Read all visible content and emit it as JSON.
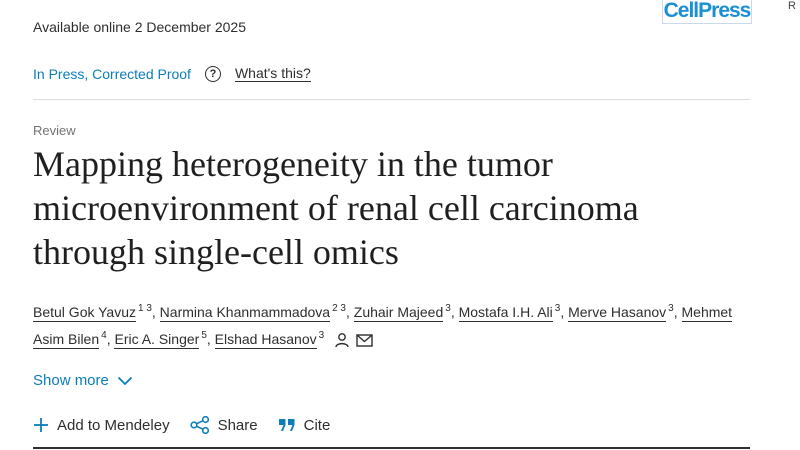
{
  "header": {
    "availability": "Available online 2 December 2025",
    "publisher_logo": "CellPress",
    "edge_text": "R"
  },
  "status": {
    "label": "In Press, Corrected Proof",
    "help_icon": "question-circle-icon",
    "whats_this": "What's this?"
  },
  "article": {
    "type": "Review",
    "title": "Mapping heterogeneity in the tumor microenvironment of renal cell carcinoma through single-cell omics"
  },
  "authors": [
    {
      "name": "Betul Gok Yavuz",
      "aff": "1 3",
      "sep": ","
    },
    {
      "name": "Narmina Khanmammadova",
      "aff": "2 3",
      "sep": ","
    },
    {
      "name": "Zuhair Majeed",
      "aff": "3",
      "sep": ","
    },
    {
      "name": "Mostafa I.H. Ali",
      "aff": "3",
      "sep": ","
    },
    {
      "name": "Merve Hasanov",
      "aff": "3",
      "sep": ","
    },
    {
      "name": "Mehmet Asim Bilen",
      "aff": "4",
      "sep": ","
    },
    {
      "name": "Eric A. Singer",
      "aff": "5",
      "sep": ","
    },
    {
      "name": "Elshad Hasanov",
      "aff": "3",
      "sep": ""
    }
  ],
  "show_more": {
    "label": "Show more",
    "icon": "chevron-down-icon"
  },
  "actions": {
    "mendeley": {
      "label": "Add to Mendeley",
      "icon": "plus-icon"
    },
    "share": {
      "label": "Share",
      "icon": "share-icon"
    },
    "cite": {
      "label": "Cite",
      "icon": "quote-icon"
    }
  },
  "colors": {
    "link": "#0c7dbb",
    "text": "#2e2e2e",
    "muted": "#737373",
    "logo": "#1a8fd6"
  }
}
